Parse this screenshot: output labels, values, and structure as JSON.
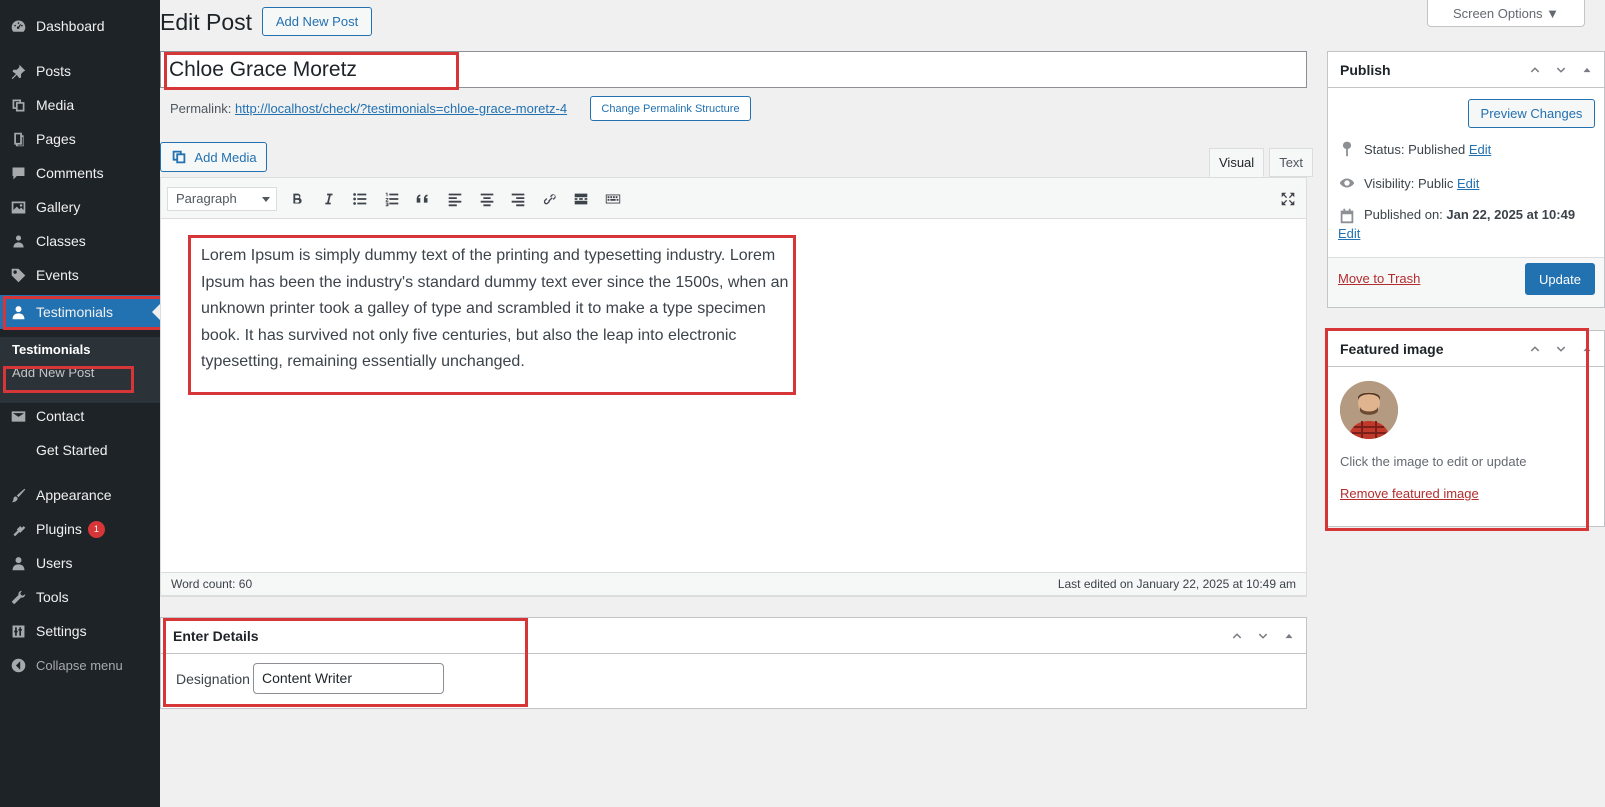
{
  "sidebar": {
    "items": [
      {
        "label": "Dashboard",
        "icon": "dashboard-icon"
      },
      {
        "label": "Posts",
        "icon": "pin-icon"
      },
      {
        "label": "Media",
        "icon": "media-icon"
      },
      {
        "label": "Pages",
        "icon": "pages-icon"
      },
      {
        "label": "Comments",
        "icon": "comment-icon"
      },
      {
        "label": "Gallery",
        "icon": "gallery-icon"
      },
      {
        "label": "Classes",
        "icon": "users-icon"
      },
      {
        "label": "Events",
        "icon": "tag-icon"
      },
      {
        "label": "Testimonials",
        "icon": "user-icon"
      },
      {
        "label": "Contact",
        "icon": "mail-icon"
      },
      {
        "label": "Get Started",
        "icon": ""
      },
      {
        "label": "Appearance",
        "icon": "brush-icon"
      },
      {
        "label": "Plugins",
        "icon": "plugin-icon",
        "badge": "1"
      },
      {
        "label": "Users",
        "icon": "user-icon"
      },
      {
        "label": "Tools",
        "icon": "wrench-icon"
      },
      {
        "label": "Settings",
        "icon": "settings-icon"
      }
    ],
    "submenu": {
      "current": "Testimonials",
      "add_new": "Add New Post"
    },
    "collapse": "Collapse menu"
  },
  "header": {
    "title": "Edit Post",
    "add_new": "Add New Post",
    "screen_options": "Screen Options ▼"
  },
  "post": {
    "title": "Chloe Grace Moretz",
    "permalink_label": "Permalink:",
    "permalink_url": "http://localhost/check/?testimonials=chloe-grace-moretz-4",
    "change_permalink": "Change Permalink Structure",
    "add_media": "Add Media",
    "tab_visual": "Visual",
    "tab_text": "Text",
    "format": "Paragraph",
    "content": "Lorem Ipsum is simply dummy text of the printing and typesetting industry. Lorem Ipsum has been the industry's standard dummy text ever since the 1500s, when an unknown printer took a galley of type and scrambled it to make a type specimen book. It has survived not only five centuries, but also the leap into electronic typesetting, remaining essentially unchanged.",
    "word_count": "Word count: 60",
    "last_edited": "Last edited on January 22, 2025 at 10:49 am"
  },
  "publish": {
    "title": "Publish",
    "preview": "Preview Changes",
    "status_label": "Status:",
    "status_value": "Published",
    "visibility_label": "Visibility:",
    "visibility_value": "Public",
    "published_label": "Published on:",
    "published_value": "Jan 22, 2025 at 10:49",
    "edit": "Edit",
    "trash": "Move to Trash",
    "update": "Update"
  },
  "featured": {
    "title": "Featured image",
    "hint": "Click the image to edit or update",
    "remove": "Remove featured image"
  },
  "details": {
    "title": "Enter Details",
    "designation_label": "Designation",
    "designation_value": "Content Writer"
  },
  "colors": {
    "accent": "#2271b1",
    "sidebar": "#1d2327",
    "highlight": "#d63638"
  }
}
